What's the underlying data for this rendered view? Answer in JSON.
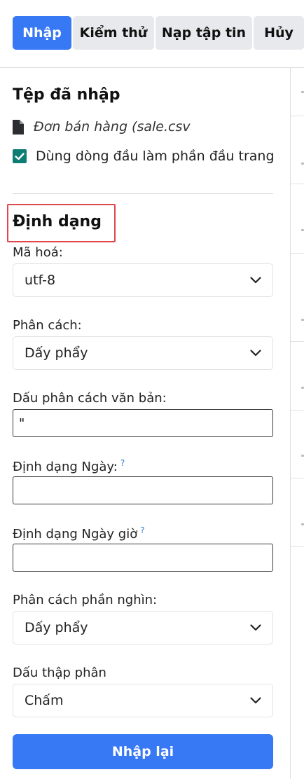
{
  "toolbar": {
    "import_label": "Nhập",
    "test_label": "Kiểm thử",
    "load_file_label": "Nạp tập tin",
    "cancel_label": "Hủy"
  },
  "imported_file": {
    "heading": "Tệp đã nhập",
    "file_name": "Đơn bán hàng (sale.csv",
    "use_first_row_checked": true,
    "use_first_row_label": "Dùng dòng đầu làm phần đầu trang"
  },
  "format": {
    "heading": "Định dạng",
    "encoding": {
      "label": "Mã hoá:",
      "value": "utf-8"
    },
    "separator": {
      "label": "Phân cách:",
      "value": "Dấy phẩy"
    },
    "text_delimiter": {
      "label": "Dấu phân cách văn bản:",
      "value": "\""
    },
    "date_format": {
      "label": "Định dạng Ngày:",
      "help": "?",
      "value": ""
    },
    "datetime_format": {
      "label": "Định dạng Ngày giờ",
      "help": "?",
      "value": ""
    },
    "thousands_separator": {
      "label": "Phân cách phần nghìn:",
      "value": "Dấy phẩy"
    },
    "decimal_separator": {
      "label": "Dấu thập phân",
      "value": "Chấm"
    }
  },
  "reimport_label": "Nhập lại",
  "colors": {
    "primary": "#3778f5",
    "checkbox": "#0d7d73",
    "highlight": "#e0474c"
  }
}
